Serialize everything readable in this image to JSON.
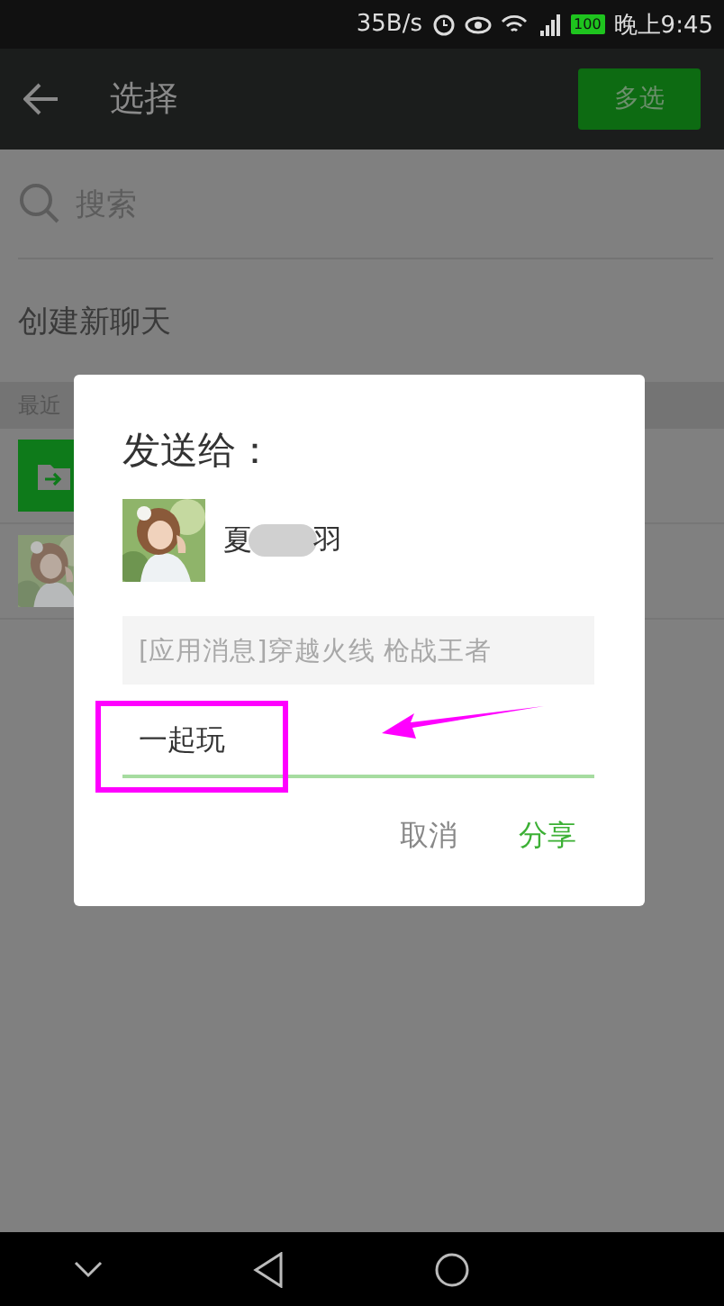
{
  "status_bar": {
    "speed": "35B/s",
    "battery": "100",
    "time": "晚上9:45"
  },
  "header": {
    "title": "选择",
    "action": "多选"
  },
  "search": {
    "placeholder": "搜索"
  },
  "create_chat": "创建新聊天",
  "section": "最近",
  "recent": [
    {
      "kind": "file"
    },
    {
      "kind": "picture"
    }
  ],
  "dialog": {
    "title": "发送给：",
    "recipient": {
      "name_start": "夏",
      "name_end": "羽",
      "kind": "picture"
    },
    "message": "[应用消息]穿越火线 枪战王者",
    "input": {
      "value": "一起玩"
    },
    "buttons": [
      {
        "label": "取消",
        "primary": false
      },
      {
        "label": "分享",
        "primary": true
      }
    ]
  }
}
